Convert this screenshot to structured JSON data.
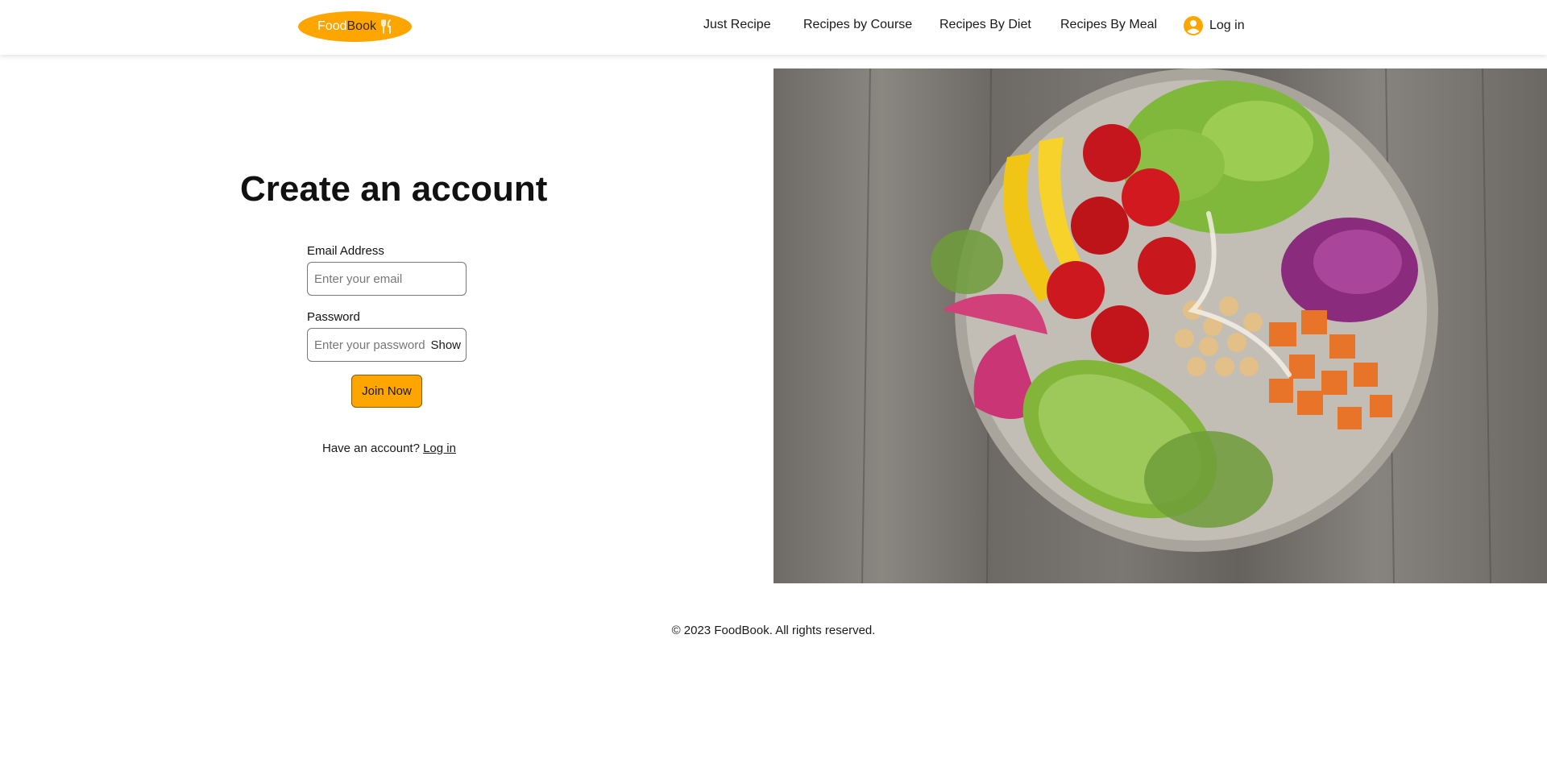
{
  "brand": {
    "part1": "Food",
    "part2": "Book",
    "icon": "fork-knife-icon",
    "color": "#ffa500"
  },
  "nav": {
    "items": [
      {
        "label": "Just Recipe"
      },
      {
        "label": "Recipes by Course"
      },
      {
        "label": "Recipes By Diet"
      },
      {
        "label": "Recipes By Meal"
      }
    ],
    "login_label": "Log in",
    "login_icon": "user-circle-icon"
  },
  "form": {
    "title": "Create an account",
    "email_label": "Email Address",
    "email_placeholder": "Enter your email",
    "email_value": "",
    "password_label": "Password",
    "password_placeholder": "Enter your password",
    "password_value": "",
    "show_label": "Show",
    "submit_label": "Join Now",
    "have_account_text": "Have an account?",
    "login_link": "Log in"
  },
  "hero": {
    "icon": "salad-bowl-image"
  },
  "footer": {
    "text": "© 2023 FoodBook. All rights reserved."
  },
  "colors": {
    "accent": "#ffa500",
    "text": "#1a1a1a"
  }
}
